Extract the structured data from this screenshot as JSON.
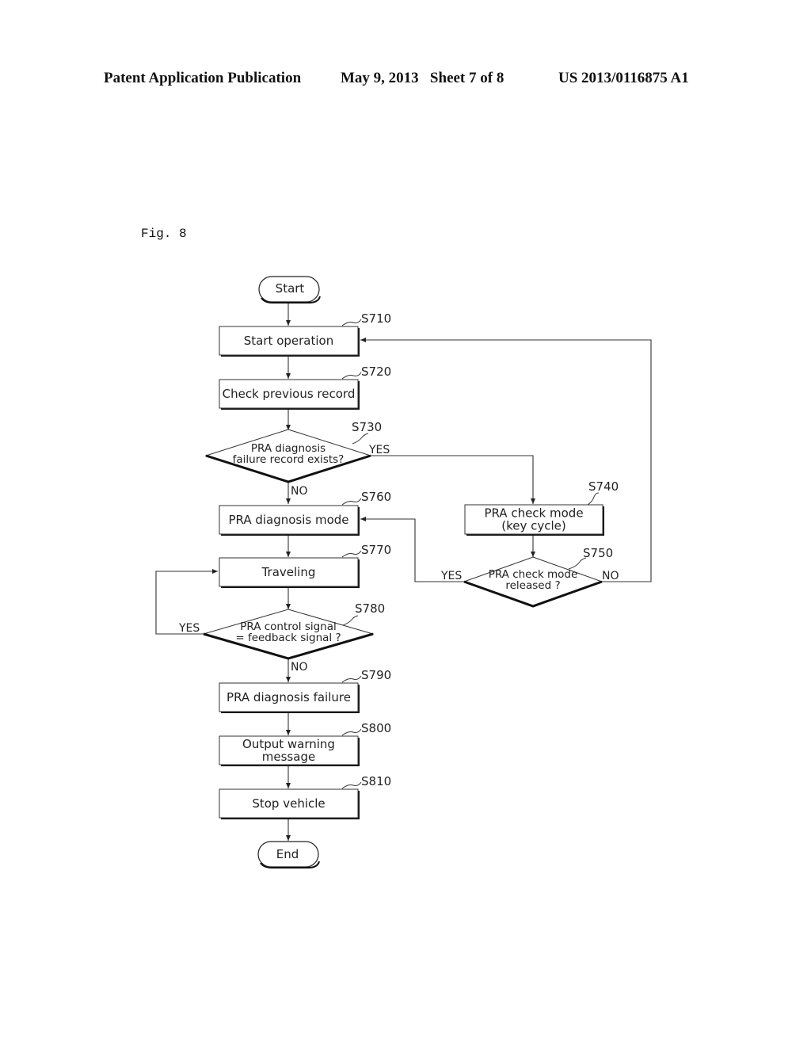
{
  "header": {
    "publication": "Patent Application Publication",
    "date_sheet": "May 9, 2013   Sheet 7 of 8",
    "patent_number": "US 2013/0116875 A1"
  },
  "figure": {
    "label": "Fig. 8"
  },
  "flowchart": {
    "start": "Start",
    "end": "End",
    "steps": {
      "s710": {
        "id": "S710",
        "lines": [
          "Start operation"
        ]
      },
      "s720": {
        "id": "S720",
        "lines": [
          "Check previous record"
        ]
      },
      "s730": {
        "id": "S730",
        "lines": [
          "PRA diagnosis",
          "failure record exists?"
        ]
      },
      "s740": {
        "id": "S740",
        "lines": [
          "PRA check mode",
          "(key cycle)"
        ]
      },
      "s750": {
        "id": "S750",
        "lines": [
          "PRA check mode",
          "released ?"
        ]
      },
      "s760": {
        "id": "S760",
        "lines": [
          "PRA diagnosis mode"
        ]
      },
      "s770": {
        "id": "S770",
        "lines": [
          "Traveling"
        ]
      },
      "s780": {
        "id": "S780",
        "lines": [
          "PRA control signal",
          "= feedback signal ?"
        ]
      },
      "s790": {
        "id": "S790",
        "lines": [
          "PRA diagnosis failure"
        ]
      },
      "s800": {
        "id": "S800",
        "lines": [
          "Output warning",
          "message"
        ]
      },
      "s810": {
        "id": "S810",
        "lines": [
          "Stop vehicle"
        ]
      }
    },
    "branches": {
      "s730_yes": "YES",
      "s730_no": "NO",
      "s750_yes": "YES",
      "s750_no": "NO",
      "s780_yes": "YES",
      "s780_no": "NO"
    }
  }
}
